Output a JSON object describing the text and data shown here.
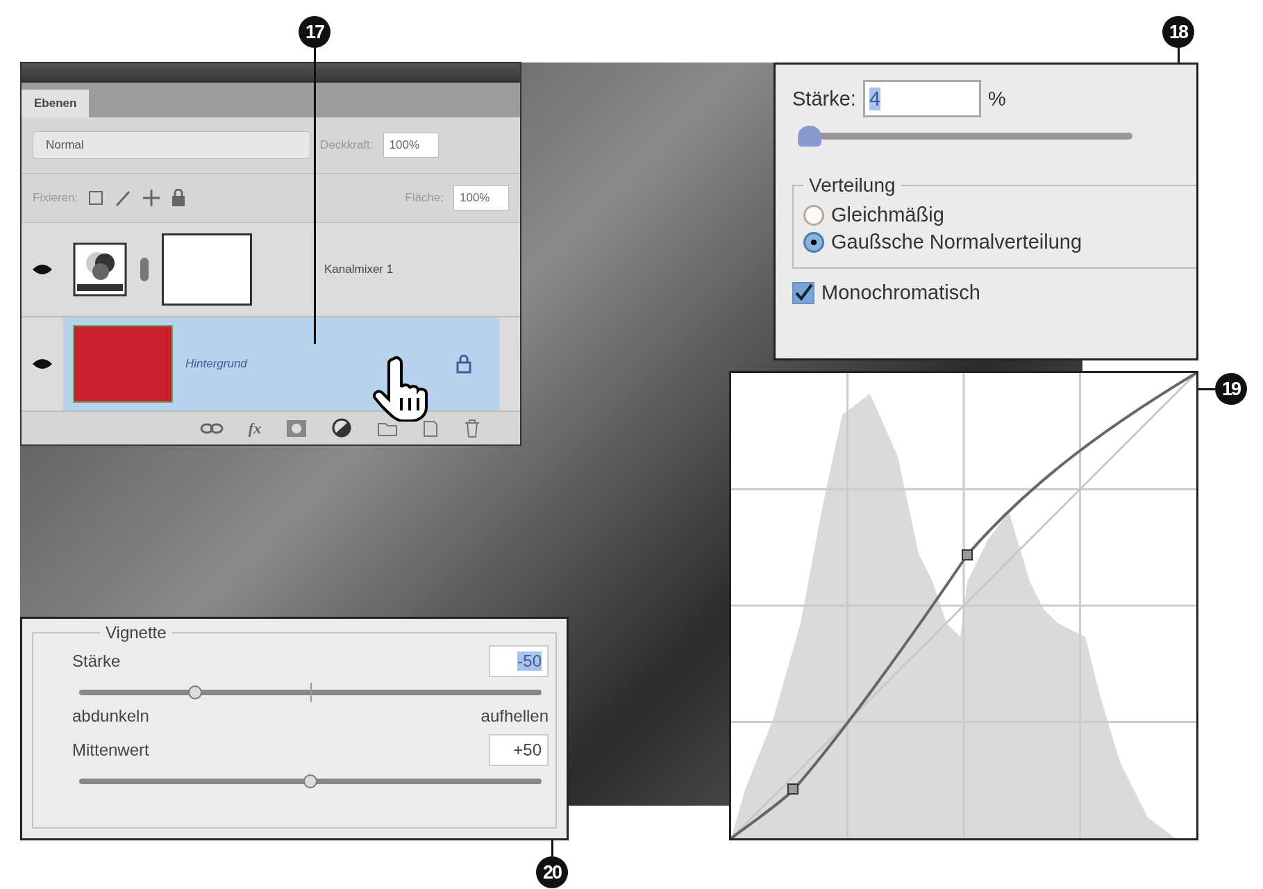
{
  "callouts": [
    {
      "number": "17"
    },
    {
      "number": "18"
    },
    {
      "number": "19"
    },
    {
      "number": "20"
    }
  ],
  "layers_panel": {
    "tabs": [
      {
        "label": "Ebenen",
        "selected": true
      }
    ],
    "blend_mode": {
      "value": "Normal"
    },
    "opacity": {
      "label": "Deckkraft:",
      "value": "100%"
    },
    "lock": {
      "label": "Fixieren:"
    },
    "fill": {
      "label": "Fläche:",
      "value": "100%"
    },
    "layers": [
      {
        "name": "Kanalmixer 1",
        "kind": "adjustment",
        "selected": false,
        "locked": false
      },
      {
        "name": "Hintergrund",
        "kind": "image",
        "selected": true,
        "locked": true
      }
    ],
    "footer": {
      "fx": "fx"
    }
  },
  "noise_panel": {
    "amount": {
      "label": "Stärke:",
      "value": "4",
      "unit": "%",
      "level": 0.01
    },
    "distribution": {
      "title": "Verteilung",
      "options": [
        {
          "label": "Gleichmäßig",
          "selected": false
        },
        {
          "label": "Gaußsche Normalverteilung",
          "selected": true
        }
      ]
    },
    "monochromatic": {
      "label": "Monochromatisch",
      "checked": true
    }
  },
  "vignette_panel": {
    "title": "Vignette",
    "sliders": [
      {
        "label": "Stärke",
        "value": "-50",
        "highlighted": true,
        "kind": "bipolar",
        "level": 0.25,
        "min_label": "abdunkeln",
        "max_label": "aufhellen"
      },
      {
        "label": "Mittenwert",
        "value": "+50",
        "highlighted": false,
        "kind": "unipolar",
        "level": 0.5
      }
    ]
  }
}
